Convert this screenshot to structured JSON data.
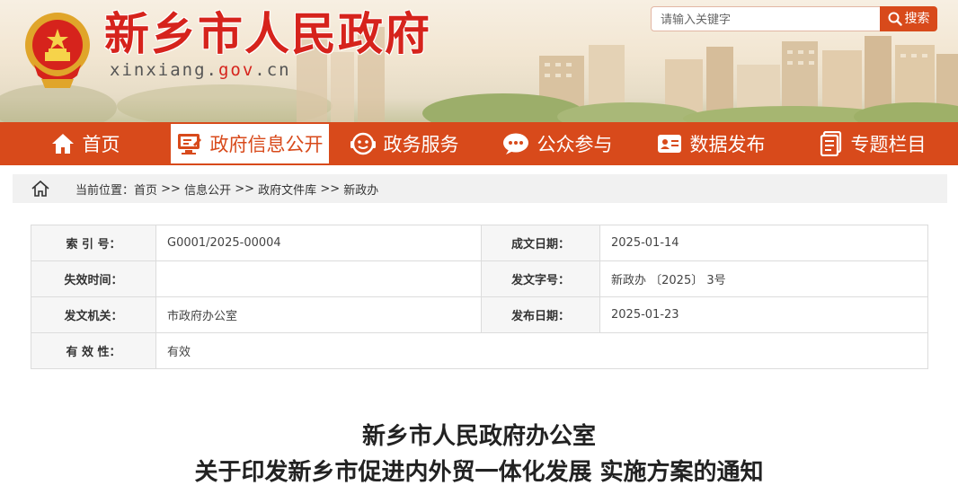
{
  "header": {
    "site_title": "新乡市人民政府",
    "domain_parts": [
      "xinxiang.",
      "gov",
      ".cn"
    ],
    "emblem_icon": "national-emblem-icon"
  },
  "search": {
    "placeholder": "请输入关键字",
    "button_label": "搜索",
    "icon": "search-icon"
  },
  "nav": {
    "items": [
      {
        "label": "首页",
        "icon": "home-icon",
        "active": false
      },
      {
        "label": "政府信息公开",
        "icon": "monitor-edit-icon",
        "active": true
      },
      {
        "label": "政务服务",
        "icon": "service-face-icon",
        "active": false
      },
      {
        "label": "公众参与",
        "icon": "chat-bubble-icon",
        "active": false
      },
      {
        "label": "数据发布",
        "icon": "id-card-icon",
        "active": false
      },
      {
        "label": "专题栏目",
        "icon": "document-icon",
        "active": false
      }
    ]
  },
  "breadcrumb": {
    "prefix": "当前位置：",
    "items": [
      "首页",
      "信息公开",
      "政府文件库",
      "新政办"
    ],
    "separator": " >> "
  },
  "info": {
    "rows": [
      {
        "l1": "索 引 号：",
        "v1": "G0001/2025-00004",
        "l2": "成文日期：",
        "v2": "2025-01-14"
      },
      {
        "l1": "失效时间：",
        "v1": "",
        "l2": "发文字号：",
        "v2": "新政办 〔2025〕 3号"
      },
      {
        "l1": "发文机关：",
        "v1": "市政府办公室",
        "l2": "发布日期：",
        "v2": "2025-01-23"
      },
      {
        "l1": "有 效 性：",
        "v1": "有效"
      }
    ]
  },
  "document": {
    "title_line1": "新乡市人民政府办公室",
    "title_line2": "关于印发新乡市促进内外贸一体化发展 实施方案的通知"
  },
  "colors": {
    "brand_red": "#d6231c",
    "nav_orange": "#d84a1b"
  }
}
